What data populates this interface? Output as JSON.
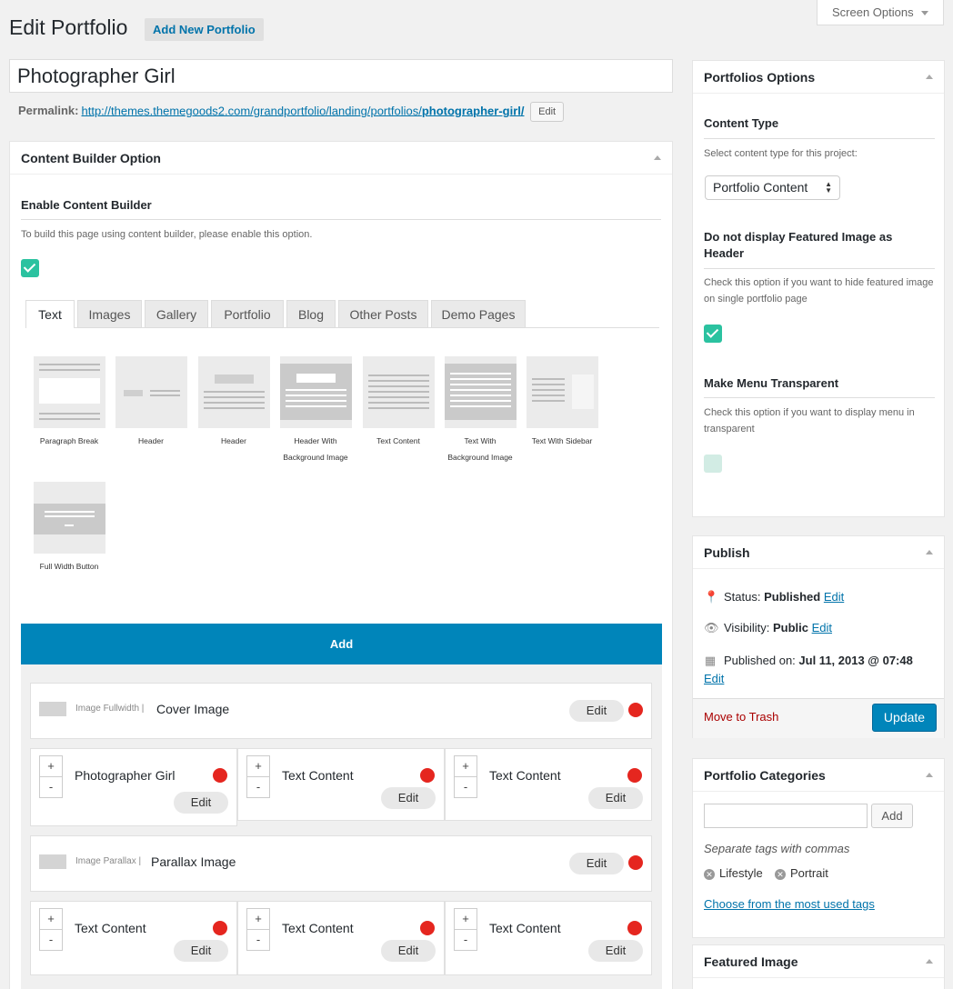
{
  "header": {
    "title": "Edit Portfolio",
    "add_new": "Add New Portfolio",
    "screen_options": "Screen Options"
  },
  "post": {
    "title": "Photographer Girl",
    "permalink_label": "Permalink:",
    "permalink_base": "http://themes.themegoods2.com/grandportfolio/landing/portfolios/",
    "permalink_slug": "photographer-girl/",
    "permalink_edit": "Edit"
  },
  "content_builder": {
    "title": "Content Builder Option",
    "enable_label": "Enable Content Builder",
    "enable_desc": "To build this page using content builder, please enable this option.",
    "enabled": true,
    "tabs": [
      "Text",
      "Images",
      "Gallery",
      "Portfolio",
      "Blog",
      "Other Posts",
      "Demo Pages"
    ],
    "active_tab": "Text",
    "modules": [
      {
        "label_1": "Paragraph Break",
        "label_2": ""
      },
      {
        "label_1": "Header",
        "label_2": ""
      },
      {
        "label_1": "Header",
        "label_2": ""
      },
      {
        "label_1": "Header With",
        "label_2": "Background Image"
      },
      {
        "label_1": "Text Content",
        "label_2": ""
      },
      {
        "label_1": "Text With",
        "label_2": "Background Image"
      },
      {
        "label_1": "Text With Sidebar",
        "label_2": ""
      },
      {
        "label_1": "Full Width Button",
        "label_2": ""
      }
    ],
    "add_label": "Add",
    "items": [
      {
        "type": "Image Fullwidth",
        "name": "Cover Image",
        "edit": "Edit"
      },
      {
        "type": "Image Parallax",
        "name": "Parallax Image",
        "edit": "Edit"
      }
    ],
    "row1": [
      {
        "name": "Photographer Girl",
        "edit": "Edit"
      },
      {
        "name": "Text Content",
        "edit": "Edit"
      },
      {
        "name": "Text Content",
        "edit": "Edit"
      }
    ],
    "row2": [
      {
        "name": "Text Content",
        "edit": "Edit"
      },
      {
        "name": "Text Content",
        "edit": "Edit"
      },
      {
        "name": "Text Content",
        "edit": "Edit"
      }
    ],
    "stepper_plus": "+",
    "stepper_minus": "-"
  },
  "portfolio_options": {
    "title": "Portfolios Options",
    "content_type_label": "Content Type",
    "content_type_desc": "Select content type for this project:",
    "content_type_value": "Portfolio Content",
    "featured_label": "Do not display Featured Image as Header",
    "featured_desc": "Check this option if you want to hide featured image on single portfolio page",
    "featured_checked": true,
    "menu_label": "Make Menu Transparent",
    "menu_desc": "Check this option if you want to display menu in transparent",
    "menu_checked": false
  },
  "publish": {
    "title": "Publish",
    "status_label": "Status:",
    "status_value": "Published",
    "visibility_label": "Visibility:",
    "visibility_value": "Public",
    "published_label": "Published on:",
    "published_value": "Jul 11, 2013 @ 07:48",
    "edit": "Edit",
    "trash": "Move to Trash",
    "update": "Update"
  },
  "categories": {
    "title": "Portfolio Categories",
    "add": "Add",
    "hint": "Separate tags with commas",
    "tags": [
      "Lifestyle",
      "Portrait"
    ],
    "most_used": "Choose from the most used tags"
  },
  "featured_image": {
    "title": "Featured Image"
  },
  "colors": {
    "accent": "#0085ba",
    "checkbox": "#2bc2a0",
    "danger": "#e5261f",
    "trash": "#aa0000"
  }
}
